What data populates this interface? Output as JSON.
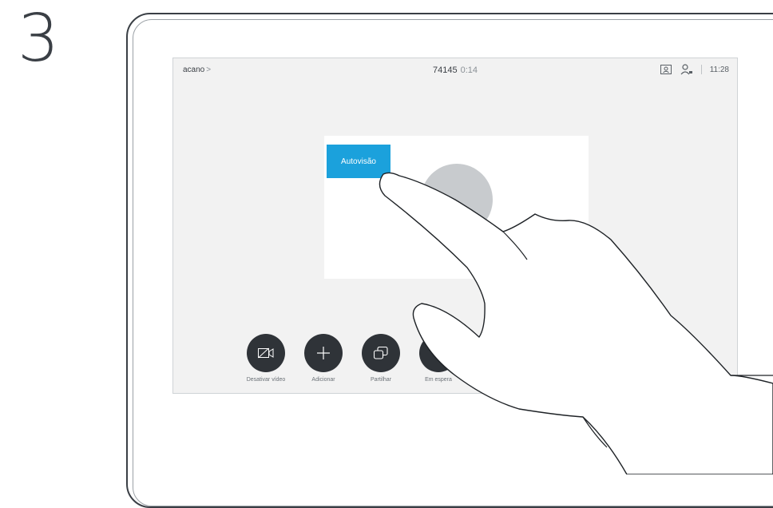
{
  "step_number": "3",
  "topbar": {
    "left_label": "acano",
    "left_chevron": ">",
    "call_number": "74145",
    "call_duration": "0:14",
    "icons": [
      "selfview-layout-icon",
      "participants-icon"
    ],
    "time": "11:28"
  },
  "selfview": {
    "label": "Autovisão"
  },
  "call_buttons": [
    {
      "label": "Desativar vídeo",
      "icon": "video-off-icon"
    },
    {
      "label": "Adicionar",
      "icon": "plus-icon"
    },
    {
      "label": "Partilhar",
      "icon": "share-icon"
    },
    {
      "label": "Em espera",
      "icon": "hold-icon"
    }
  ],
  "device_controls": {
    "volume_icon": "speaker-icon",
    "mute_icon": "microphone-mute-icon"
  },
  "colors": {
    "accent": "#1ba1dc",
    "button_bg": "#2f3338",
    "outline": "#3a3f45"
  }
}
